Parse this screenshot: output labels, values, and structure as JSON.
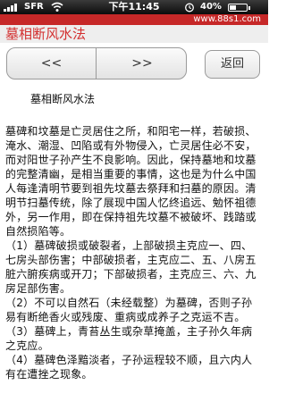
{
  "status_bar": {
    "carrier": "SFR",
    "time": "下午11:45",
    "battery_percent": "40%",
    "battery_level": 0.4,
    "signal_icon": "signal-bars-icon",
    "wifi_icon": "wifi-icon",
    "alarm_icon": "alarm-clock-icon",
    "battery_icon": "battery-icon"
  },
  "site_strip": {
    "text": "www.88s1.com"
  },
  "header": {
    "title": "墓相断风水法"
  },
  "nav": {
    "prev_label": "<<",
    "next_label": ">>",
    "back_label": "返回"
  },
  "article": {
    "title": "墓相断风水法",
    "paragraphs": [
      "墓碑和坟墓是亡灵居住之所，和阳宅一样，若破损、淹水、潮湿、凹陷或有外物侵入，亡灵居住必不安，而对阳世子孙产生不良影响。因此，保持墓地和坟墓的完整清幽，是相当重要的事情，这也是为什么中国人每逢清明节要到祖先坟墓去祭拜和扫墓的原因。清明节扫墓传统，除了展现中国人忆终追远、勉怀祖德外，另一作用，即在保持祖先坟墓不被破坏、践踏或自然损陷等。",
      "（1）墓碑破损或破裂者，上部破损主克应一、四、七房头部伤害；中部破损者，主克应二、五、八房五脏六腑疾病或开刀；下部破损者，主克应三、六、九房足部伤害。",
      "（2）不可以自然石（未经载整）为墓碑，否则子孙易有断绝香火或残废、重病或成养子之克运不吉。",
      "（3）墓碑上，青苔丛生或杂草掩盖，主子孙久年病之克应。",
      "（4）墓碑色泽黯淡者，子孙运程较不顺，且六内人有在遭挫之现象。"
    ]
  },
  "colors": {
    "heading_red": "#d32f2f",
    "strip_red": "#c62828",
    "status_bar_black": "#0c0c0c"
  }
}
